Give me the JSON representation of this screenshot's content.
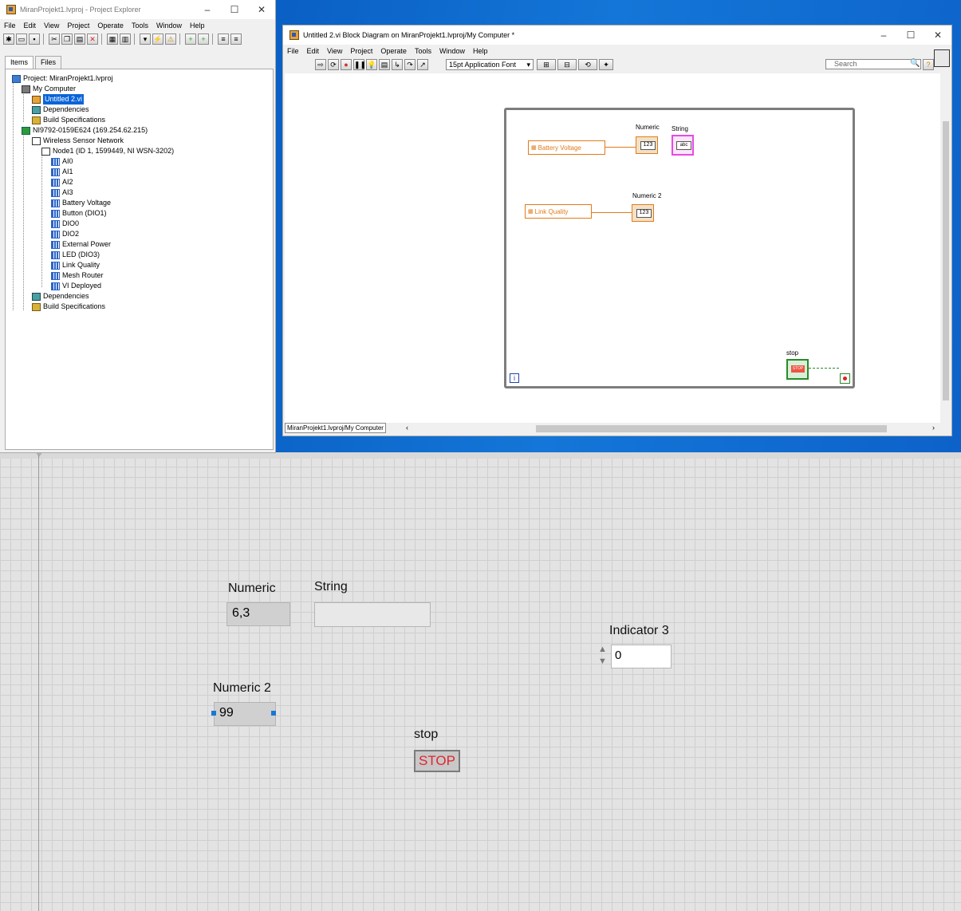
{
  "project_explorer": {
    "title": "MiranProjekt1.lvproj - Project Explorer",
    "menu": [
      "File",
      "Edit",
      "View",
      "Project",
      "Operate",
      "Tools",
      "Window",
      "Help"
    ],
    "tabs": [
      "Items",
      "Files"
    ],
    "tree": [
      "Project: MiranProjekt1.lvproj",
      "My Computer",
      "Untitled 2.vi",
      "Dependencies",
      "Build Specifications",
      "NI9792-0159E624 (169.254.62.215)",
      "Wireless Sensor Network",
      "Node1 (ID 1, 1599449, NI WSN-3202)",
      "AI0",
      "AI1",
      "AI2",
      "AI3",
      "Battery Voltage",
      "Button (DIO1)",
      "DIO0",
      "DIO2",
      "External Power",
      "LED (DIO3)",
      "Link Quality",
      "Mesh Router",
      "VI Deployed",
      "Dependencies",
      "Build Specifications"
    ]
  },
  "block_diagram": {
    "title": "Untitled 2.vi Block Diagram on MiranProjekt1.lvproj/My Computer *",
    "menu": [
      "File",
      "Edit",
      "View",
      "Project",
      "Operate",
      "Tools",
      "Window",
      "Help"
    ],
    "font_selector": "15pt Application Font",
    "search_placeholder": "Search",
    "status_path": "MiranProjekt1.lvproj/My Computer",
    "nodes": {
      "battery_voltage": "Battery Voltage",
      "link_quality": "Link Quality",
      "numeric_label": "Numeric",
      "string_label": "String",
      "numeric2_label": "Numeric 2",
      "stop_label": "stop",
      "numeric_terminal": "123",
      "numeric2_terminal": "123",
      "string_terminal": "abc",
      "stop_terminal": "STOP",
      "iteration": "i"
    }
  },
  "front_panel": {
    "numeric": {
      "label": "Numeric",
      "value": "6,3"
    },
    "string": {
      "label": "String",
      "value": ""
    },
    "numeric2": {
      "label": "Numeric 2",
      "value": "99"
    },
    "indicator3": {
      "label": "Indicator 3",
      "value": "0"
    },
    "stop": {
      "label": "stop",
      "button": "STOP"
    }
  }
}
